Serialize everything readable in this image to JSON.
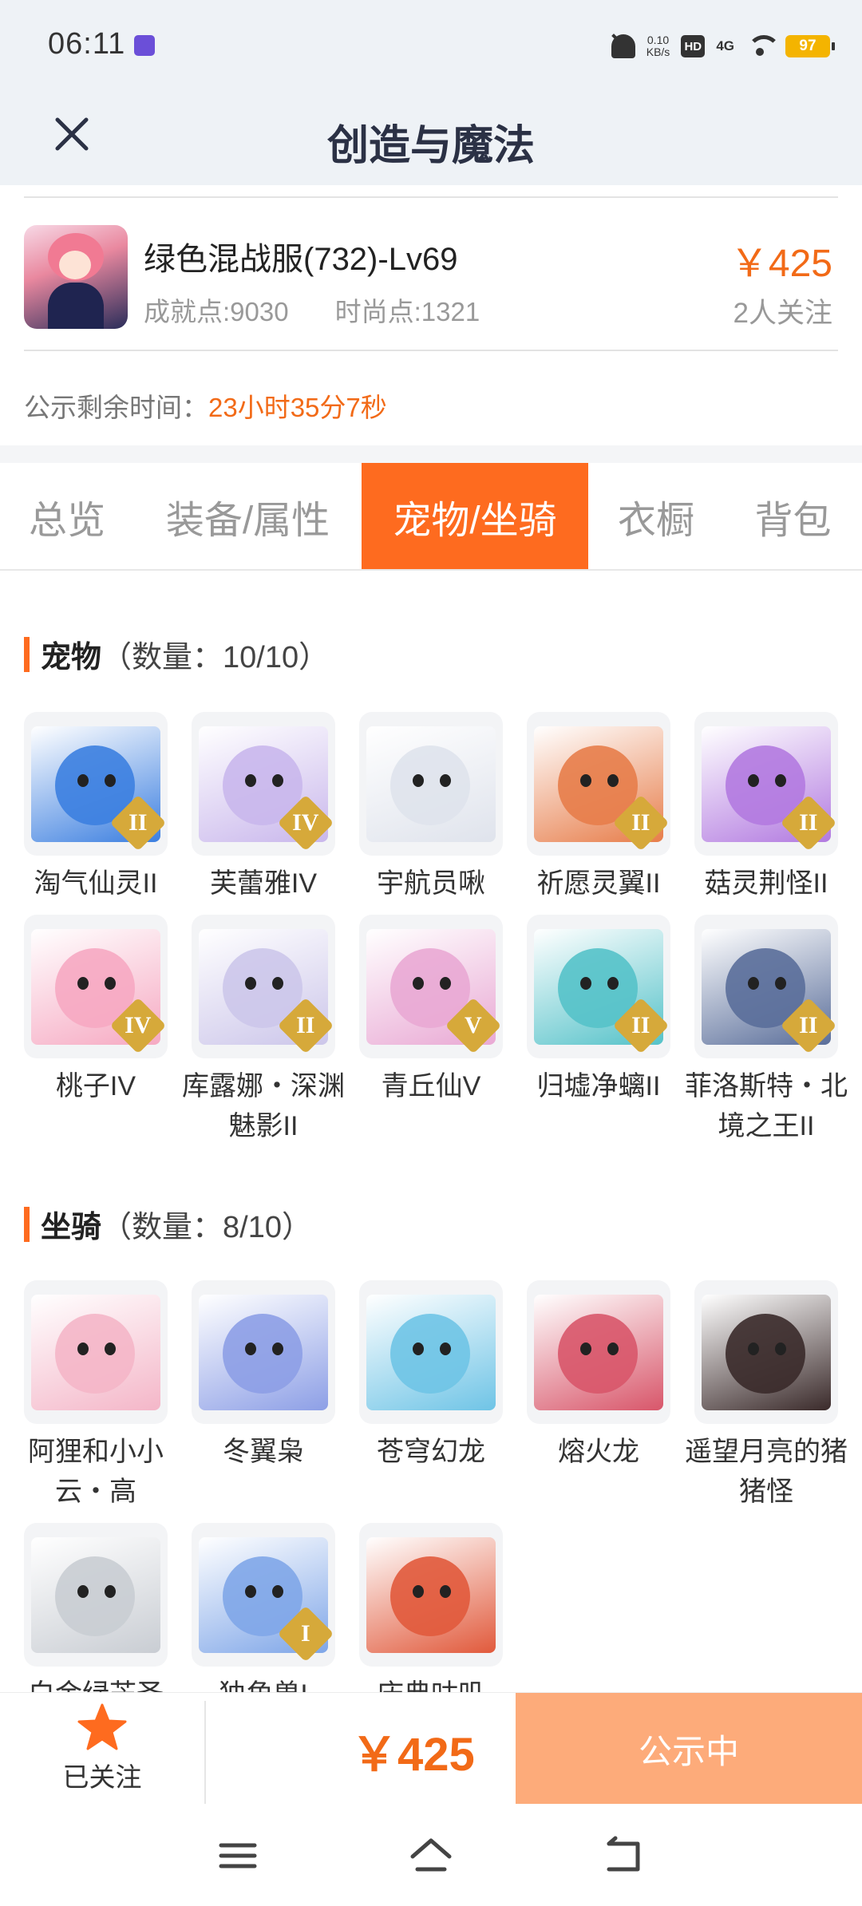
{
  "status_bar": {
    "time": "06:11",
    "net_speed_value": "0.10",
    "net_speed_unit": "KB/s",
    "hd_label": "HD",
    "signal_label": "4G",
    "battery": "97"
  },
  "header": {
    "title": "创造与魔法",
    "close_icon": "close-icon"
  },
  "listing": {
    "title": "绿色混战服(732)-Lv69",
    "achievement": "成就点:9030",
    "fashion": "时尚点:1321",
    "price": "￥425",
    "followers": "2人关注",
    "countdown_label": "公示剩余时间：",
    "countdown_value": "23小时35分7秒"
  },
  "tabs": [
    {
      "label": "总览",
      "active": false
    },
    {
      "label": "装备/属性",
      "active": false
    },
    {
      "label": "宠物/坐骑",
      "active": true
    },
    {
      "label": "衣橱",
      "active": false
    },
    {
      "label": "背包",
      "active": false
    }
  ],
  "pets": {
    "title": "宠物",
    "count": "（数量：10/10）",
    "items": [
      {
        "name": "淘气仙灵II",
        "rank": "II",
        "color": "#3c7fe0"
      },
      {
        "name": "芙蕾雅IV",
        "rank": "IV",
        "color": "#c9b7ec"
      },
      {
        "name": "宇航员啾",
        "rank": "",
        "color": "#dfe3ec"
      },
      {
        "name": "祈愿灵翼II",
        "rank": "II",
        "color": "#e77d4a"
      },
      {
        "name": "菇灵荆怪II",
        "rank": "II",
        "color": "#b27ae0"
      },
      {
        "name": "桃子IV",
        "rank": "IV",
        "color": "#f6a9c2"
      },
      {
        "name": "库露娜・深渊魅影II",
        "rank": "II",
        "color": "#ccc6ea"
      },
      {
        "name": "青丘仙V",
        "rank": "V",
        "color": "#e9a9d4"
      },
      {
        "name": "归墟净螭II",
        "rank": "II",
        "color": "#55c2c9"
      },
      {
        "name": "菲洛斯特・北境之王II",
        "rank": "II",
        "color": "#5a6e9a"
      }
    ]
  },
  "mounts": {
    "title": "坐骑",
    "count": "（数量：8/10）",
    "items": [
      {
        "name": "阿狸和小小云・高",
        "rank": "",
        "color": "#f4b6c8"
      },
      {
        "name": "冬翼枭",
        "rank": "",
        "color": "#8d9fe6"
      },
      {
        "name": "苍穹幻龙",
        "rank": "",
        "color": "#6fc4e6"
      },
      {
        "name": "熔火龙",
        "rank": "",
        "color": "#d8566a"
      },
      {
        "name": "遥望月亮的猪猪怪",
        "rank": "",
        "color": "#3a2a2a"
      },
      {
        "name": "白金绿芒圣",
        "rank": "",
        "color": "#c9cdd3"
      },
      {
        "name": "独角兽I",
        "rank": "I",
        "color": "#7fa6e8"
      },
      {
        "name": "庆典咕叽",
        "rank": "",
        "color": "#e15a3c"
      }
    ]
  },
  "bottom_bar": {
    "fav_label": "已关注",
    "price": "￥425",
    "status_label": "公示中"
  },
  "colors": {
    "accent": "#fe6b1f",
    "price": "#f26a17",
    "status_button": "#fdab7a",
    "header_bg": "#eef2f6"
  }
}
